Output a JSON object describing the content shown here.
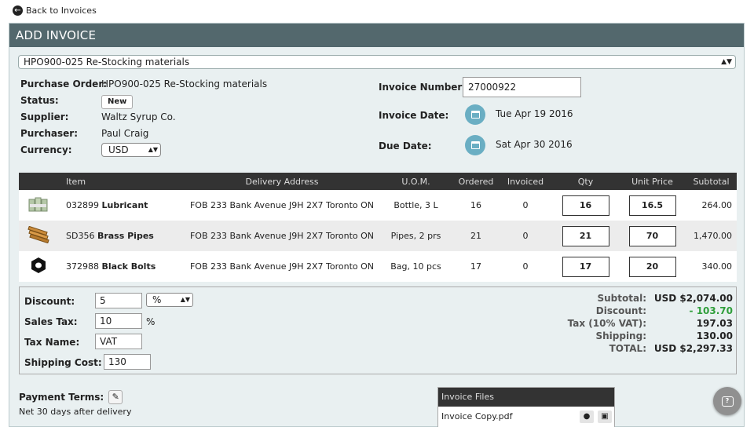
{
  "nav": {
    "back_label": "Back to Invoices",
    "back_icon": "arrow-left-circle-icon"
  },
  "panel": {
    "title": "ADD INVOICE"
  },
  "po_select": {
    "selected": "HPO900-025 Re-Stocking materials"
  },
  "details": {
    "purchase_order_label": "Purchase Order:",
    "purchase_order_value": "HPO900-025 Re-Stocking materials",
    "status_label": "Status:",
    "status_value": "New",
    "supplier_label": "Supplier:",
    "supplier_value": "Waltz Syrup Co.",
    "purchaser_label": "Purchaser:",
    "purchaser_value": "Paul Craig",
    "currency_label": "Currency:",
    "currency_value": "USD"
  },
  "invoice": {
    "number_label": "Invoice Number:",
    "number_value": "27000922",
    "date_label": "Invoice Date:",
    "date_value": "Tue Apr 19 2016",
    "due_label": "Due Date:",
    "due_value": "Sat Apr 30 2016"
  },
  "table": {
    "headers": [
      "Item",
      "Delivery Address",
      "U.O.M.",
      "Ordered",
      "Invoiced",
      "Qty",
      "Unit Price",
      "Subtotal"
    ],
    "rows": [
      {
        "code": "032899",
        "name": "Lubricant",
        "address": "FOB 233 Bank Avenue J9H 2X7 Toronto ON",
        "uom": "Bottle, 3 L",
        "ordered": "16",
        "invoiced": "0",
        "qty": "16",
        "unit_price": "16.5",
        "subtotal": "264.00",
        "thumb": "lubricant-thumbnail"
      },
      {
        "code": "SD356",
        "name": "Brass Pipes",
        "address": "FOB 233 Bank Avenue J9H 2X7 Toronto ON",
        "uom": "Pipes, 2 prs",
        "ordered": "21",
        "invoiced": "0",
        "qty": "21",
        "unit_price": "70",
        "subtotal": "1,470.00",
        "thumb": "brass-pipes-thumbnail"
      },
      {
        "code": "372988",
        "name": "Black Bolts",
        "address": "FOB 233 Bank Avenue J9H 2X7 Toronto ON",
        "uom": "Bag, 10 pcs",
        "ordered": "17",
        "invoiced": "0",
        "qty": "17",
        "unit_price": "20",
        "subtotal": "340.00",
        "thumb": "black-bolts-thumbnail"
      }
    ]
  },
  "adjustments": {
    "discount_label": "Discount:",
    "discount_value": "5",
    "discount_type": "%",
    "sales_tax_label": "Sales Tax:",
    "sales_tax_value": "10",
    "sales_tax_unit": "%",
    "tax_name_label": "Tax Name:",
    "tax_name_value": "VAT",
    "shipping_label": "Shipping Cost:",
    "shipping_value": "130"
  },
  "summary": {
    "subtotal_label": "Subtotal:",
    "subtotal_value": "USD $2,074.00",
    "discount_label": "Discount:",
    "discount_value": "- 103.70",
    "tax_label": "Tax (10% VAT):",
    "tax_value": "197.03",
    "shipping_label": "Shipping:",
    "shipping_value": "130.00",
    "total_label": "TOTAL:",
    "total_value": "USD $2,297.33",
    "discount_color": "#2e9e3a"
  },
  "payment_terms": {
    "label": "Payment Terms:",
    "value": "Net 30 days after delivery"
  },
  "files": {
    "header": "Invoice Files",
    "items": [
      {
        "name": "Invoice Copy.pdf"
      }
    ]
  },
  "colors": {
    "header_bg": "#53686d",
    "panel_bg": "#e9f0f1",
    "calendar_accent": "#6aaec3"
  }
}
